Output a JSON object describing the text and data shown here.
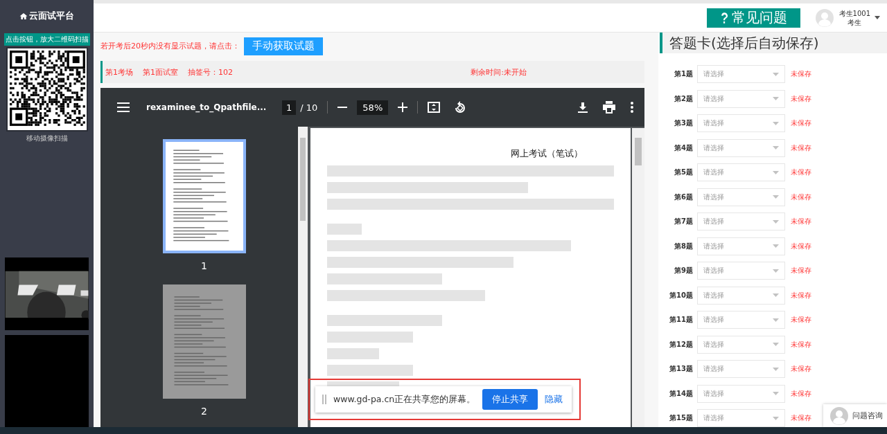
{
  "sidebar": {
    "title": "云面试平台",
    "qr_button": "点击按钮，放大二维码扫描",
    "qr_caption": "移动摄像扫描"
  },
  "header": {
    "faq_button": "常见问题",
    "user_name": "考生1001",
    "user_role": "考生"
  },
  "notice": {
    "text": "若开考后20秒内没有显示试题，请点击：",
    "button": "手动获取试题"
  },
  "info_bar": {
    "room": "第1考场",
    "interview_room": "第1面试室",
    "draw_number": "抽签号：102",
    "remaining": "剩余时间:未开始"
  },
  "pdf_viewer": {
    "file_name": "rexaminee_to_Qpathfile...",
    "page": "1",
    "page_total": "/ 10",
    "zoom": "58%",
    "thumbnails": [
      {
        "label": "1",
        "selected": true
      },
      {
        "label": "2",
        "selected": false
      }
    ],
    "page_heading": "网上考试（笔试）"
  },
  "share_bar": {
    "text": "www.gd-pa.cn正在共享您的屏幕。",
    "stop_button": "停止共享",
    "hide_link": "隐藏"
  },
  "answer_card": {
    "title": "答题卡(选择后自动保存)",
    "questions": [
      {
        "label": "第1题",
        "placeholder": "请选择",
        "status": "未保存"
      },
      {
        "label": "第2题",
        "placeholder": "请选择",
        "status": "未保存"
      },
      {
        "label": "第3题",
        "placeholder": "请选择",
        "status": "未保存"
      },
      {
        "label": "第4题",
        "placeholder": "请选择",
        "status": "未保存"
      },
      {
        "label": "第5题",
        "placeholder": "请选择",
        "status": "未保存"
      },
      {
        "label": "第6题",
        "placeholder": "请选择",
        "status": "未保存"
      },
      {
        "label": "第7题",
        "placeholder": "请选择",
        "status": "未保存"
      },
      {
        "label": "第8题",
        "placeholder": "请选择",
        "status": "未保存"
      },
      {
        "label": "第9题",
        "placeholder": "请选择",
        "status": "未保存"
      },
      {
        "label": "第10题",
        "placeholder": "请选择",
        "status": "未保存"
      },
      {
        "label": "第11题",
        "placeholder": "请选择",
        "status": "未保存"
      },
      {
        "label": "第12题",
        "placeholder": "请选择",
        "status": "未保存"
      },
      {
        "label": "第13题",
        "placeholder": "请选择",
        "status": "未保存"
      },
      {
        "label": "第14题",
        "placeholder": "请选择",
        "status": "未保存"
      },
      {
        "label": "第15题",
        "placeholder": "请选择",
        "status": "未保存"
      }
    ]
  },
  "help_widget": {
    "label": "问题咨询"
  }
}
